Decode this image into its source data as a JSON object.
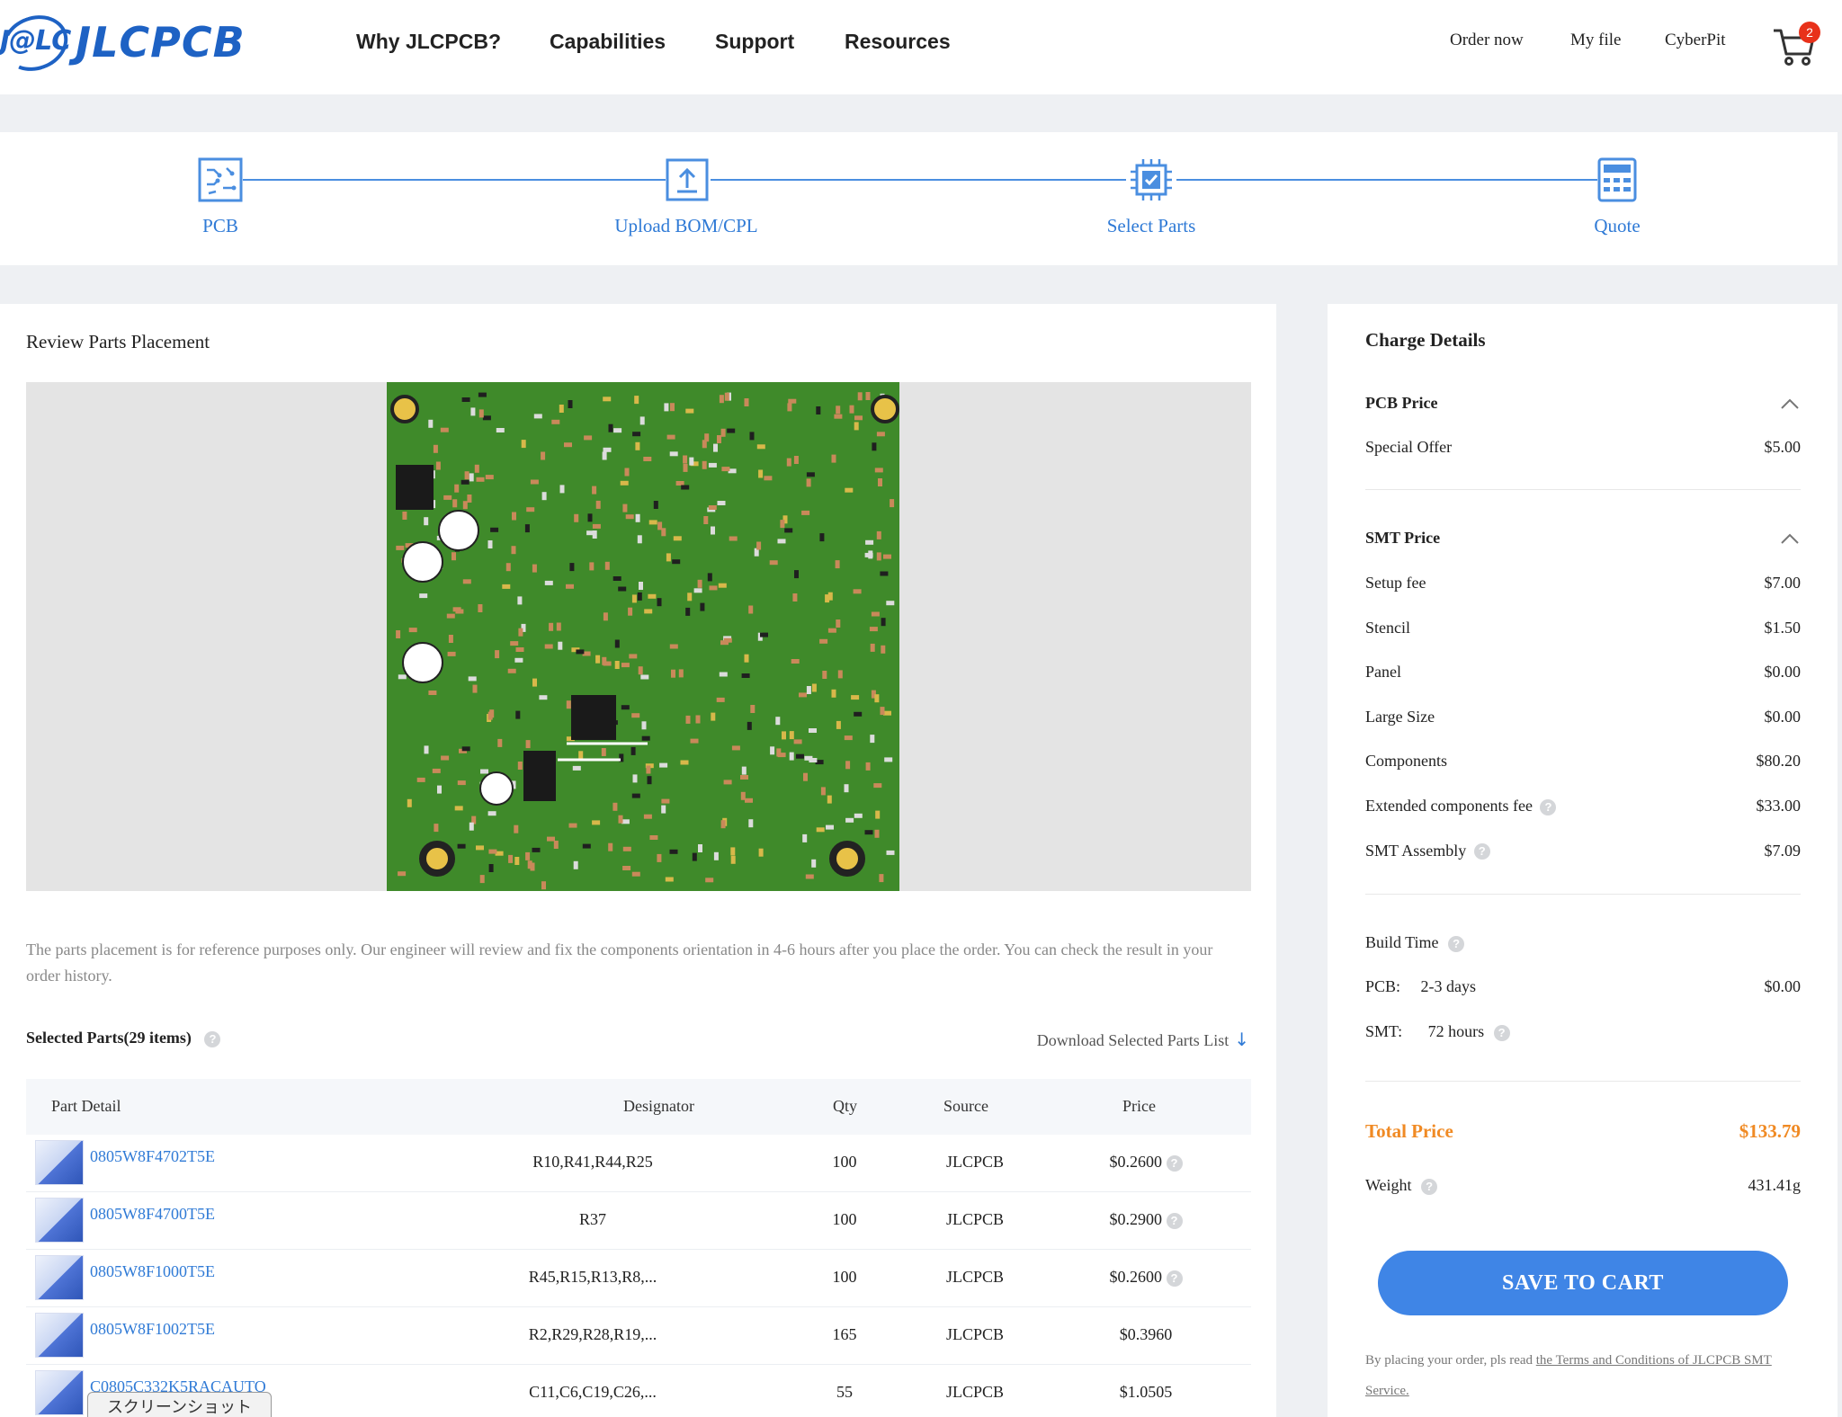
{
  "header": {
    "logo_mark": "J@LC",
    "logo_text": "JLCPCB",
    "nav": [
      "Why JLCPCB?",
      "Capabilities",
      "Support",
      "Resources"
    ],
    "right_links": [
      "Order now",
      "My file",
      "CyberPit"
    ],
    "cart_count": "2"
  },
  "steps": [
    "PCB",
    "Upload BOM/CPL",
    "Select Parts",
    "Quote"
  ],
  "review": {
    "title": "Review Parts Placement",
    "disclaimer": "The parts placement is for reference purposes only. Our engineer will review and fix the components orientation in 4-6 hours after you place the order. You can check the result in your order history."
  },
  "selected": {
    "title": "Selected Parts(29 items)",
    "download": "Download Selected Parts List",
    "columns": [
      "Part Detail",
      "Designator",
      "Qty",
      "Source",
      "Price"
    ],
    "rows": [
      {
        "part": "0805W8F4702T5E",
        "designator": "R10,R41,R44,R25",
        "qty": "100",
        "source": "JLCPCB",
        "price": "$0.2600",
        "help": true
      },
      {
        "part": "0805W8F4700T5E",
        "designator": "R37",
        "qty": "100",
        "source": "JLCPCB",
        "price": "$0.2900",
        "help": true
      },
      {
        "part": "0805W8F1000T5E",
        "designator": "R45,R15,R13,R8,...",
        "qty": "100",
        "source": "JLCPCB",
        "price": "$0.2600",
        "help": true
      },
      {
        "part": "0805W8F1002T5E",
        "designator": "R2,R29,R28,R19,...",
        "qty": "165",
        "source": "JLCPCB",
        "price": "$0.3960",
        "help": false
      },
      {
        "part": "C0805C332K5RACAUTO",
        "designator": "C11,C6,C19,C26,...",
        "qty": "55",
        "source": "JLCPCB",
        "price": "$1.0505",
        "help": false
      }
    ]
  },
  "tooltip": "スクリーンショット",
  "charges": {
    "title": "Charge Details",
    "pcb_section": "PCB Price",
    "pcb_rows": [
      {
        "label": "Special Offer",
        "value": "$5.00"
      }
    ],
    "smt_section": "SMT Price",
    "smt_rows": [
      {
        "label": "Setup fee",
        "value": "$7.00"
      },
      {
        "label": "Stencil",
        "value": "$1.50"
      },
      {
        "label": "Panel",
        "value": "$0.00"
      },
      {
        "label": "Large Size",
        "value": "$0.00"
      },
      {
        "label": "Components",
        "value": "$80.20"
      },
      {
        "label": "Extended components fee",
        "value": "$33.00"
      },
      {
        "label": "SMT Assembly",
        "value": "$7.09"
      }
    ],
    "build_time_label": "Build Time",
    "pcb_time_label": "PCB:",
    "pcb_time": "2-3 days",
    "pcb_time_value": "$0.00",
    "smt_time_label": "SMT:",
    "smt_time": "72 hours",
    "total_label": "Total Price",
    "total_value": "$133.79",
    "weight_label": "Weight",
    "weight_value": "431.41g",
    "save_button": "SAVE TO CART",
    "terms_prefix": "By placing your order, pls read",
    "terms_link": "the Terms and Conditions of JLCPCB SMT Service."
  },
  "colors": {
    "brand": "#1e62c4",
    "step_accent": "#2f7ad6",
    "total_accent": "#f08a24",
    "button": "#3f85e6",
    "pcb_green": "#3f8a2a"
  }
}
